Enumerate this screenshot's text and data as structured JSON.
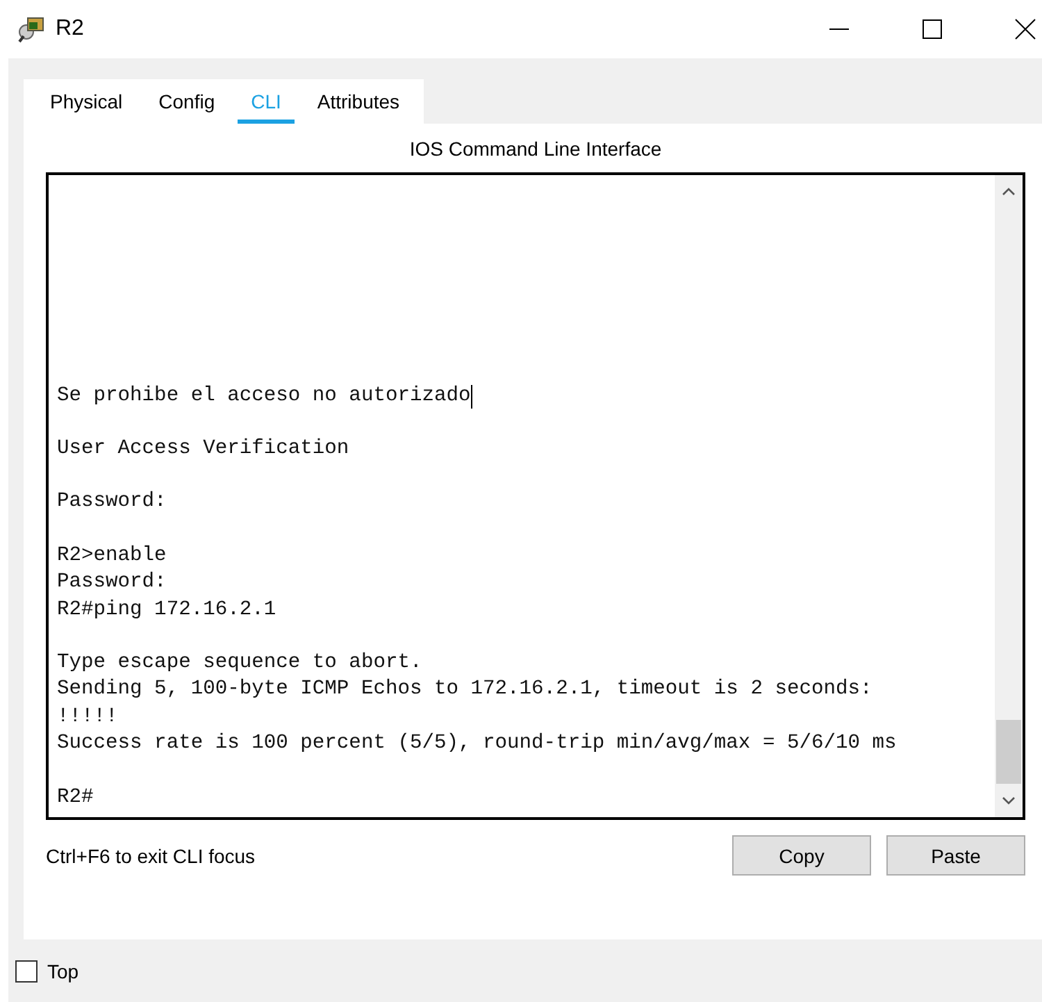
{
  "window": {
    "title": "R2"
  },
  "tabs": [
    {
      "label": "Physical",
      "selected": false
    },
    {
      "label": "Config",
      "selected": false
    },
    {
      "label": "CLI",
      "selected": true
    },
    {
      "label": "Attributes",
      "selected": false
    }
  ],
  "panel_title": "IOS Command Line Interface",
  "terminal": {
    "blocks": [
      [
        {
          "text": "Se prohibe el acceso no autorizado",
          "cursor": true
        }
      ],
      [
        {
          "text": "User Access Verification",
          "cursor": false
        }
      ],
      [
        {
          "text": "Password:",
          "cursor": false
        }
      ],
      [
        {
          "text": "R2>enable",
          "cursor": false
        },
        {
          "text": "Password:",
          "cursor": false
        },
        {
          "text": "R2#ping 172.16.2.1",
          "cursor": false
        }
      ],
      [
        {
          "text": "Type escape sequence to abort.",
          "cursor": false
        },
        {
          "text": "Sending 5, 100-byte ICMP Echos to 172.16.2.1, timeout is 2 seconds:",
          "cursor": false
        },
        {
          "text": "!!!!!",
          "cursor": false
        },
        {
          "text": "Success rate is 100 percent (5/5), round-trip min/avg/max = 5/6/10 ms",
          "cursor": false
        }
      ],
      [
        {
          "text": "R2#",
          "cursor": false
        }
      ]
    ]
  },
  "hint": "Ctrl+F6 to exit CLI focus",
  "buttons": [
    "Copy",
    "Paste"
  ],
  "top_checkbox": {
    "label": "Top",
    "checked": false
  }
}
